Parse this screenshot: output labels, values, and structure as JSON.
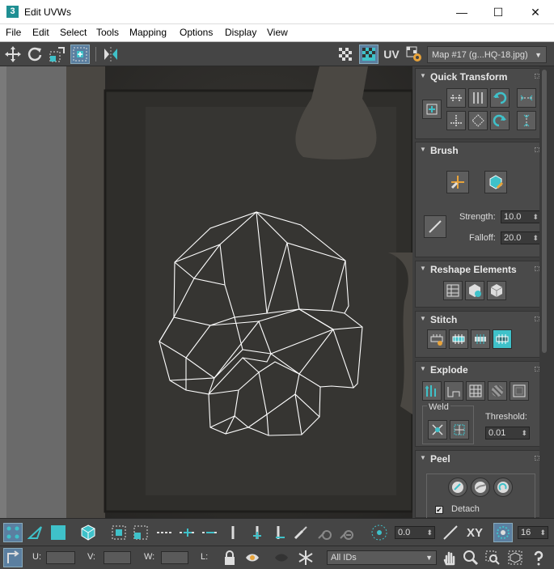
{
  "window": {
    "app_icon": "3",
    "title": "Edit UVWs",
    "minimize": "—",
    "maximize": "☐",
    "close": "✕"
  },
  "menu": [
    "File",
    "Edit",
    "Select",
    "Tools",
    "Mapping",
    "Options",
    "Display",
    "View"
  ],
  "toolbar": {
    "uv_label": "UV",
    "map_selector": "Map #17 (g...HQ-18.jpg)"
  },
  "quick_transform": {
    "title": "Quick Transform"
  },
  "brush": {
    "title": "Brush",
    "strength_label": "Strength:",
    "strength_value": "10.0",
    "falloff_label": "Falloff:",
    "falloff_value": "20.0"
  },
  "reshape": {
    "title": "Reshape Elements"
  },
  "stitch": {
    "title": "Stitch"
  },
  "explode": {
    "title": "Explode",
    "weld_label": "Weld",
    "threshold_label": "Threshold:",
    "threshold_value": "0.01"
  },
  "peel": {
    "title": "Peel",
    "detach_label": "Detach"
  },
  "bottom": {
    "angle_value": "0.0",
    "xy_label": "XY",
    "grid_value": "16",
    "u_label": "U:",
    "v_label": "V:",
    "w_label": "W:",
    "l_label": "L:",
    "ids_value": "All IDs"
  },
  "colors": {
    "accent": "#3fc1c9",
    "panel": "#4a4a4a",
    "toolbar": "#454545"
  }
}
